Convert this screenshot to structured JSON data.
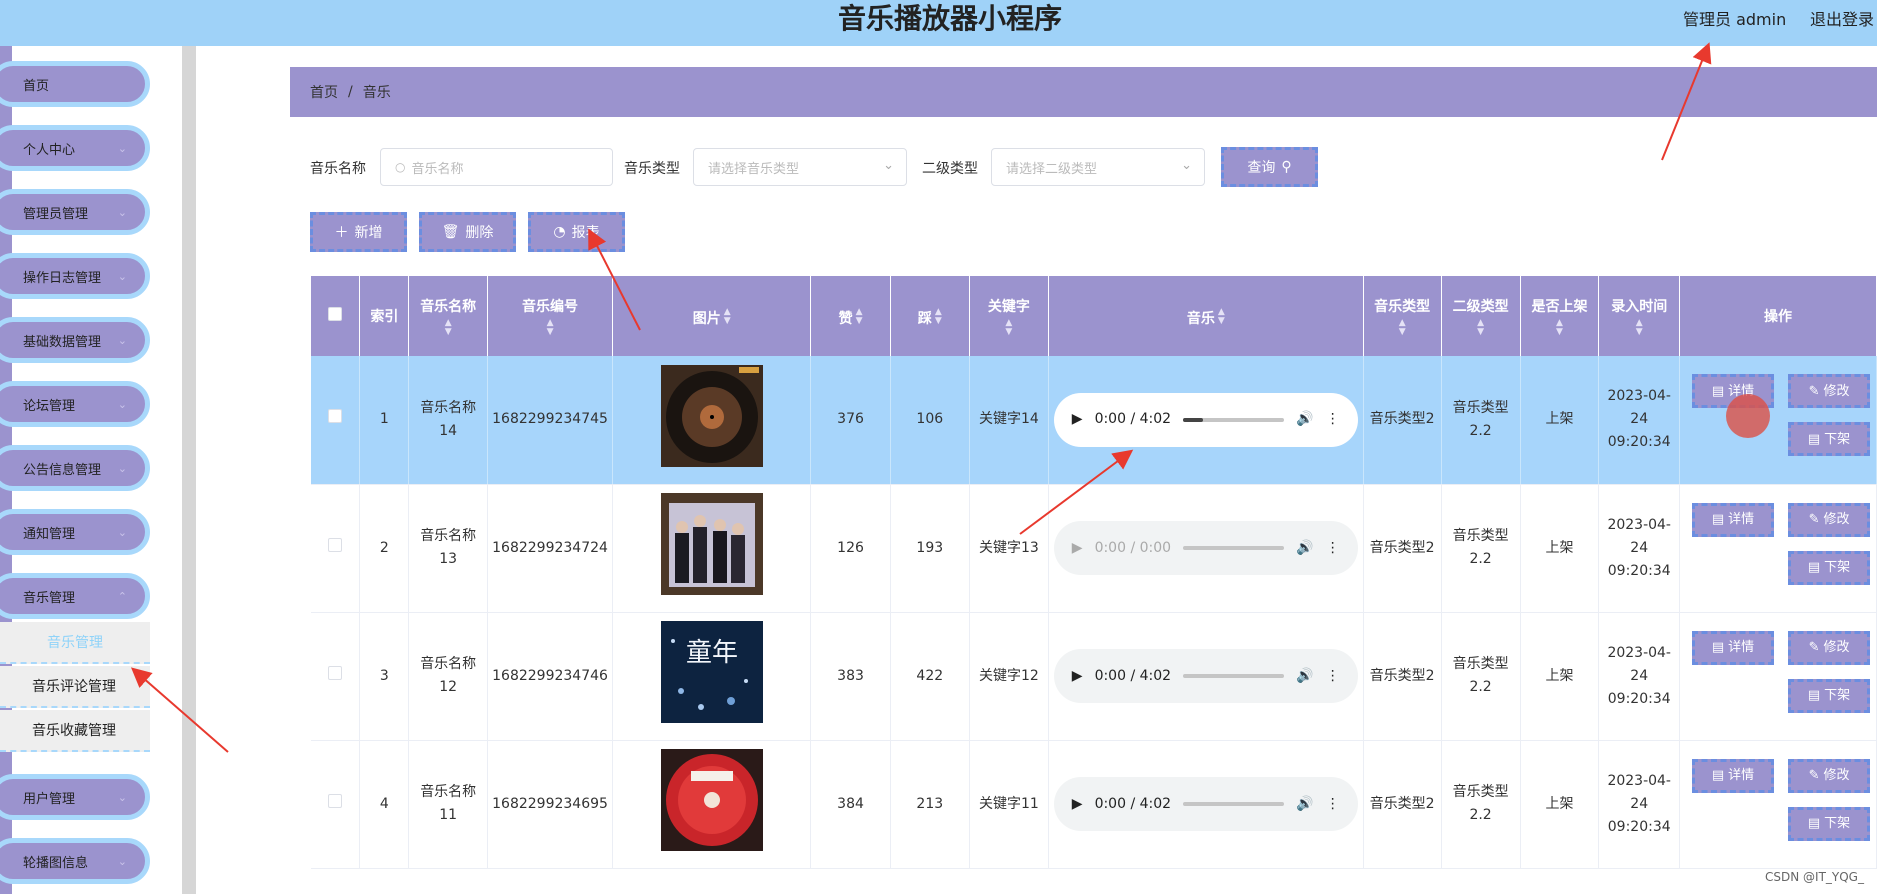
{
  "header": {
    "title": "音乐播放器小程序",
    "admin_label": "管理员 admin",
    "logout_label": "退出登录"
  },
  "sidebar": {
    "items": [
      {
        "label": "首页",
        "name": "sidebar-item-home",
        "has_chevron": false
      },
      {
        "label": "个人中心",
        "name": "sidebar-item-profile",
        "has_chevron": true
      },
      {
        "label": "管理员管理",
        "name": "sidebar-item-admin",
        "has_chevron": true
      },
      {
        "label": "操作日志管理",
        "name": "sidebar-item-oplog",
        "has_chevron": true
      },
      {
        "label": "基础数据管理",
        "name": "sidebar-item-basedata",
        "has_chevron": true
      },
      {
        "label": "论坛管理",
        "name": "sidebar-item-forum",
        "has_chevron": true
      },
      {
        "label": "公告信息管理",
        "name": "sidebar-item-notice",
        "has_chevron": true
      },
      {
        "label": "通知管理",
        "name": "sidebar-item-notify",
        "has_chevron": true
      },
      {
        "label": "音乐管理",
        "name": "sidebar-item-music",
        "has_chevron": true
      },
      {
        "label": "用户管理",
        "name": "sidebar-item-users",
        "has_chevron": true
      },
      {
        "label": "轮播图信息",
        "name": "sidebar-item-carousel",
        "has_chevron": true
      }
    ],
    "submenu": [
      "音乐管理",
      "音乐评论管理",
      "音乐收藏管理"
    ]
  },
  "breadcrumb": {
    "home": "首页",
    "separator": "/",
    "current": "音乐"
  },
  "search": {
    "name_label": "音乐名称",
    "name_placeholder": "音乐名称",
    "type_label": "音乐类型",
    "type_placeholder": "请选择音乐类型",
    "subtype_label": "二级类型",
    "subtype_placeholder": "请选择二级类型",
    "query_button": "查询"
  },
  "toolbar": {
    "add": "新增",
    "delete": "删除",
    "report": "报表"
  },
  "table": {
    "headers": {
      "index": "索引",
      "name": "音乐名称",
      "number": "音乐编号",
      "image": "图片",
      "likes": "赞",
      "dislikes": "踩",
      "keyword": "关键字",
      "music": "音乐",
      "type": "音乐类型",
      "subtype": "二级类型",
      "listed": "是否上架",
      "time": "录入时间",
      "ops": "操作"
    },
    "rows": [
      {
        "index": "1",
        "name": "音乐名称14",
        "number": "1682299234745",
        "likes": "376",
        "dislikes": "106",
        "keyword": "关键字14",
        "audio_time": "0:00 / 4:02",
        "audio_progress": 0.2,
        "type": "音乐类型2",
        "subtype": "音乐类型2.2",
        "listed": "上架",
        "time": "2023-04-24 09:20:34",
        "image_icon": "vinyl-record-cover-1"
      },
      {
        "index": "2",
        "name": "音乐名称13",
        "number": "1682299234724",
        "likes": "126",
        "dislikes": "193",
        "keyword": "关键字13",
        "audio_time": "0:00 / 0:00",
        "audio_progress": 0,
        "type": "音乐类型2",
        "subtype": "音乐类型2.2",
        "listed": "上架",
        "time": "2023-04-24 09:20:34",
        "image_icon": "band-album-cover"
      },
      {
        "index": "3",
        "name": "音乐名称12",
        "number": "1682299234746",
        "likes": "383",
        "dislikes": "422",
        "keyword": "关键字12",
        "audio_time": "0:00 / 4:02",
        "audio_progress": 0,
        "type": "音乐类型2",
        "subtype": "音乐类型2.2",
        "listed": "上架",
        "time": "2023-04-24 09:20:34",
        "image_icon": "childhood-album-cover",
        "image_text": "童年"
      },
      {
        "index": "4",
        "name": "音乐名称11",
        "number": "1682299234695",
        "likes": "384",
        "dislikes": "213",
        "keyword": "关键字11",
        "audio_time": "0:00 / 4:02",
        "audio_progress": 0,
        "type": "音乐类型2",
        "subtype": "音乐类型2.2",
        "listed": "上架",
        "time": "2023-04-24 09:20:34",
        "image_icon": "red-record-cover"
      }
    ],
    "row_buttons": {
      "detail": "详情",
      "edit": "修改",
      "unlist": "下架"
    }
  },
  "watermark": "CSDN @IT_YQG_",
  "colors": {
    "topbar": "#9fd2f8",
    "accent": "#9b93ce",
    "selected_row": "#a7d5fb",
    "annotation_arrow": "#e8392e"
  }
}
